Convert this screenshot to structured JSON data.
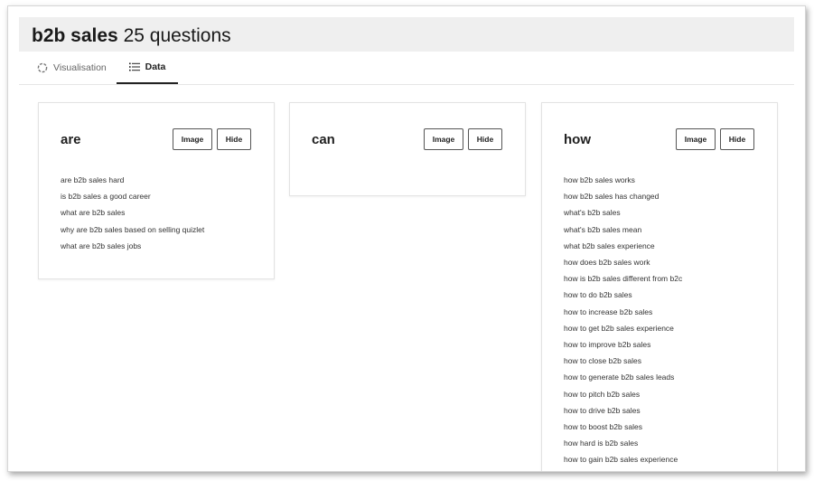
{
  "header": {
    "title_keyword": "b2b sales",
    "title_suffix": "25 questions"
  },
  "tabs": [
    {
      "label": "Visualisation",
      "icon": "loading-circle-icon",
      "active": false
    },
    {
      "label": "Data",
      "icon": "list-icon",
      "active": true
    }
  ],
  "buttons": {
    "image": "Image",
    "hide": "Hide"
  },
  "panels": [
    {
      "title": "are",
      "items": [
        "are b2b sales hard",
        "is b2b sales a good career",
        "what are b2b sales",
        "why are b2b sales based on selling quizlet",
        "what are b2b sales jobs"
      ]
    },
    {
      "title": "can",
      "items": []
    },
    {
      "title": "how",
      "items": [
        "how b2b sales works",
        "how b2b sales has changed",
        "what's b2b sales",
        "what's b2b sales mean",
        "what b2b sales experience",
        "how does b2b sales work",
        "how is b2b sales different from b2c",
        "how to do b2b sales",
        "how to increase b2b sales",
        "how to get b2b sales experience",
        "how to improve b2b sales",
        "how to close b2b sales",
        "how to generate b2b sales leads",
        "how to pitch b2b sales",
        "how to drive b2b sales",
        "how to boost b2b sales",
        "how hard is b2b sales",
        "how to gain b2b sales experience"
      ]
    }
  ]
}
